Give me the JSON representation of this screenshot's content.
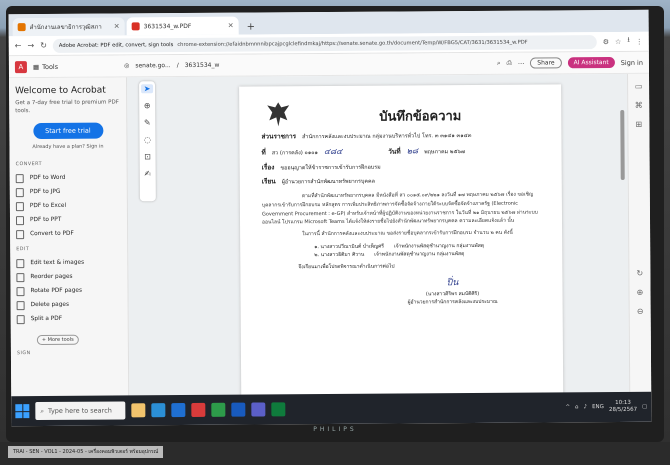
{
  "browser": {
    "tabs": [
      {
        "label": "สำนักงานเลขาธิการวุฒิสภา",
        "active": false
      },
      {
        "label": "3631534_w.PDF",
        "active": true
      }
    ],
    "new_tab": "+",
    "address_prefix": "Adobe Acrobat: PDF edit, convert, sign tools",
    "address_url": "chrome-extension://efaidnbmnnnibpcajpcglclefindmkaj/https://senate.senate.go.th/document/Temp/W/FBG5/CAT/3631/3631534_w.PDF"
  },
  "acrobat": {
    "tools_label": "Tools",
    "file_host": "senate.go...",
    "file_name": "3631534_w",
    "share_label": "Share",
    "ai_label": "AI Assistant",
    "sign_label": "Sign in"
  },
  "left_panel": {
    "title": "Welcome to Acrobat",
    "desc": "Get a 7-day free trial to premium PDF tools.",
    "trial_button": "Start free trial",
    "already": "Already have a plan? Sign in",
    "convert_header": "CONVERT",
    "convert_items": [
      "PDF to Word",
      "PDF to JPG",
      "PDF to Excel",
      "PDF to PPT",
      "Convert to PDF"
    ],
    "edit_header": "EDIT",
    "edit_items": [
      "Edit text & images",
      "Reorder pages",
      "Rotate PDF pages",
      "Delete pages",
      "Split a PDF"
    ],
    "more_tools": "+ More tools",
    "sign_header": "SIGN"
  },
  "document": {
    "title": "บันทึกข้อความ",
    "agency_label": "ส่วนราชการ",
    "agency_value": "สำนักการคลังและงบประมาณ กลุ่มงานบริหารทั่วไป โทร. ๓ ๓๑๔๑ ๓๑๔๓",
    "ref_label": "ที่",
    "ref_value": "สว (การคลัง) ๐๑๐๑",
    "ref_hw": "๔๘๔",
    "date_label": "วันที่",
    "date_hw": "๒๘",
    "date_value": "พฤษภาคม ๒๕๖๗",
    "subject_label": "เรื่อง",
    "subject_value": "ขออนุญาตให้ข้าราชการเข้ารับการฝึกอบรม",
    "to_label": "เรียน",
    "to_value": "ผู้อำนวยการสำนักพัฒนาทรัพยากรบุคคล",
    "para1": "ตามที่สำนักพัฒนาทรัพยากรบุคคล มีหนังสือที่ สว ๐๐๑๕.๐๙/๒๒๑ ลงวันที่ ๑๗ พฤษภาคม ๒๕๖๗ เรื่อง ขอเชิญบุคลากรเข้ารับการฝึกอบรม หลักสูตร การเพิ่มประสิทธิภาพการจัดซื้อจัดจ้างภายใต้ระบบจัดซื้อจัดจ้างภาครัฐ (Electronic Government Procurement : e-GP) สำหรับเจ้าหน้าที่ผู้ปฏิบัติงานของหน่วยงานราชการ ในวันที่ ๒๑ มิถุนายน ๒๕๖๗ ผ่านระบบออนไลน์ โปรแกรม Microsoft Teams ได้แจ้งให้ส่งรายชื่อไปยังสำนักพัฒนาทรัพยากรบุคคล ความละเอียดแจ้งแล้ว นั้น",
    "para2": "ในการนี้ สำนักการคลังและงบประมาณ ขอส่งรายชื่อบุคลากรเข้ารับการฝึกอบรม จำนวน ๒ คน ดังนี้",
    "names": [
      {
        "name": "๑. นางสาวปวีณามินต์ บำเพ็ญศรี",
        "role": "เจ้าพนักงานพัสดุชำนาญงาน กลุ่มงานพัสดุ"
      },
      {
        "name": "๒. นางสาวธิติมา ศิวาน",
        "role": "เจ้าพนักงานพัสดุชำนาญงาน กลุ่มงานพัสดุ"
      }
    ],
    "closing": "จึงเรียนมาเพื่อโปรดพิจารณาดำเนินการต่อไป",
    "signer_hw": "ปิ่น",
    "signer_name": "(นางสาวศิริพร สมบัติศิริ)",
    "signer_title": "ผู้อำนวยการสำนักการคลังและงบประมาณ"
  },
  "taskbar": {
    "search_placeholder": "Type here to search",
    "time": "10:13",
    "date": "28/5/2567",
    "lang": "ENG"
  },
  "monitor_brand": "PHILIPS",
  "note_text": "TRAI - SEN - VOL1 - 2024-05 - เครื่องคอมพิวเตอร์ พร้อมอุปกรณ์"
}
